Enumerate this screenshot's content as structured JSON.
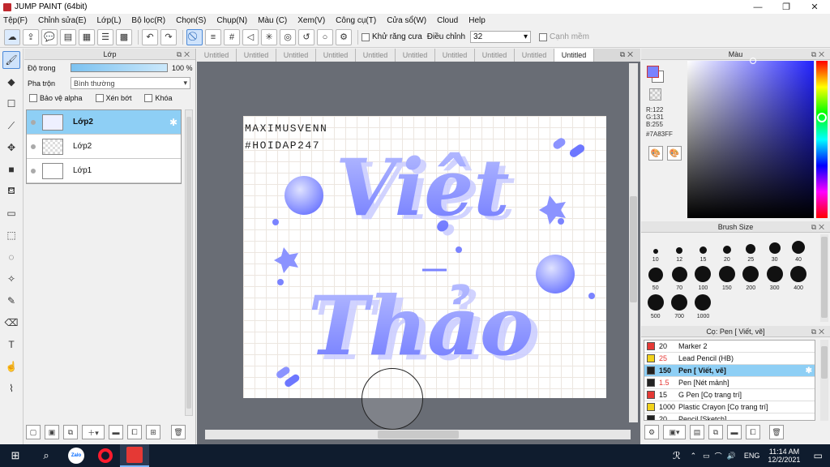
{
  "window": {
    "title": "JUMP PAINT (64bit)",
    "minimize": "—",
    "maximize": "❐",
    "close": "✕"
  },
  "menu": [
    "Tệp(F)",
    "Chỉnh sửa(E)",
    "Lớp(L)",
    "Bộ lọc(R)",
    "Chọn(S)",
    "Chụp(N)",
    "Màu (C)",
    "Xem(V)",
    "Công cụ(T)",
    "Cửa sổ(W)",
    "Cloud",
    "Help"
  ],
  "toolbar": {
    "antialias_label": "Khử răng cưa",
    "adjust_label": "Điều chỉnh",
    "adjust_value": "32",
    "smooth_edge_label": "Cạnh mềm"
  },
  "layer_panel": {
    "title": "Lớp",
    "opacity_label": "Độ trong",
    "opacity_value": "100 %",
    "opacity_fraction": 1.0,
    "blend_label": "Pha trộn",
    "blend_value": "Bình thường",
    "protect_alpha": "Bảo vệ alpha",
    "clip": "Xén bớt",
    "lock": "Khóa",
    "layers": [
      {
        "name": "Lớp2",
        "active": true
      },
      {
        "name": "Lớp2",
        "active": false
      },
      {
        "name": "Lớp1",
        "active": false
      }
    ]
  },
  "tabs": [
    "Untitled",
    "Untitled",
    "Untitled",
    "Untitled",
    "Untitled",
    "Untitled",
    "Untitled",
    "Untitled",
    "Untitled",
    "Untitled"
  ],
  "artwork": {
    "signature": "MAXIMUSVENN",
    "hashtag": "#HOIDAP247",
    "word1": "Việt",
    "word2": "Thảo",
    "dash": "—",
    "primary_color": "#7a83ff"
  },
  "color_panel": {
    "title": "Màu",
    "r": "R:122",
    "g": "G:131",
    "b": "B:255",
    "hex": "#7A83FF",
    "fg_color": "#7a83ff"
  },
  "brush_panel": {
    "title": "Brush Size",
    "sizes": [
      "10",
      "12",
      "15",
      "20",
      "25",
      "30",
      "40",
      "50",
      "70",
      "100",
      "150",
      "200",
      "300",
      "400",
      "500",
      "700",
      "1000"
    ]
  },
  "tool_panel": {
    "title": "Cọ: Pen [ Viết, vẽ]",
    "items": [
      {
        "size": "20",
        "name": "Marker 2",
        "color": "#e53935",
        "active": false
      },
      {
        "size": "25",
        "name": "Lead Pencil (HB)",
        "color": "#f2d21b",
        "active": false
      },
      {
        "size": "150",
        "name": "Pen [ Viết, vẽ]",
        "color": "#222222",
        "active": true
      },
      {
        "size": "1.5",
        "name": "Pen [Nét mảnh]",
        "color": "#222222",
        "active": false
      },
      {
        "size": "15",
        "name": "G Pen [Cọ trang trí]",
        "color": "#e53935",
        "active": false
      },
      {
        "size": "1000",
        "name": "Plastic Crayon [Cọ trang trí]",
        "color": "#f2d21b",
        "active": false
      },
      {
        "size": "20",
        "name": "Pencil [Sketch]",
        "color": "#222222",
        "active": false
      }
    ]
  },
  "taskbar": {
    "zalo": "Zalo",
    "lang": "ENG",
    "time": "11:14 AM",
    "date": "12/2/2021"
  }
}
